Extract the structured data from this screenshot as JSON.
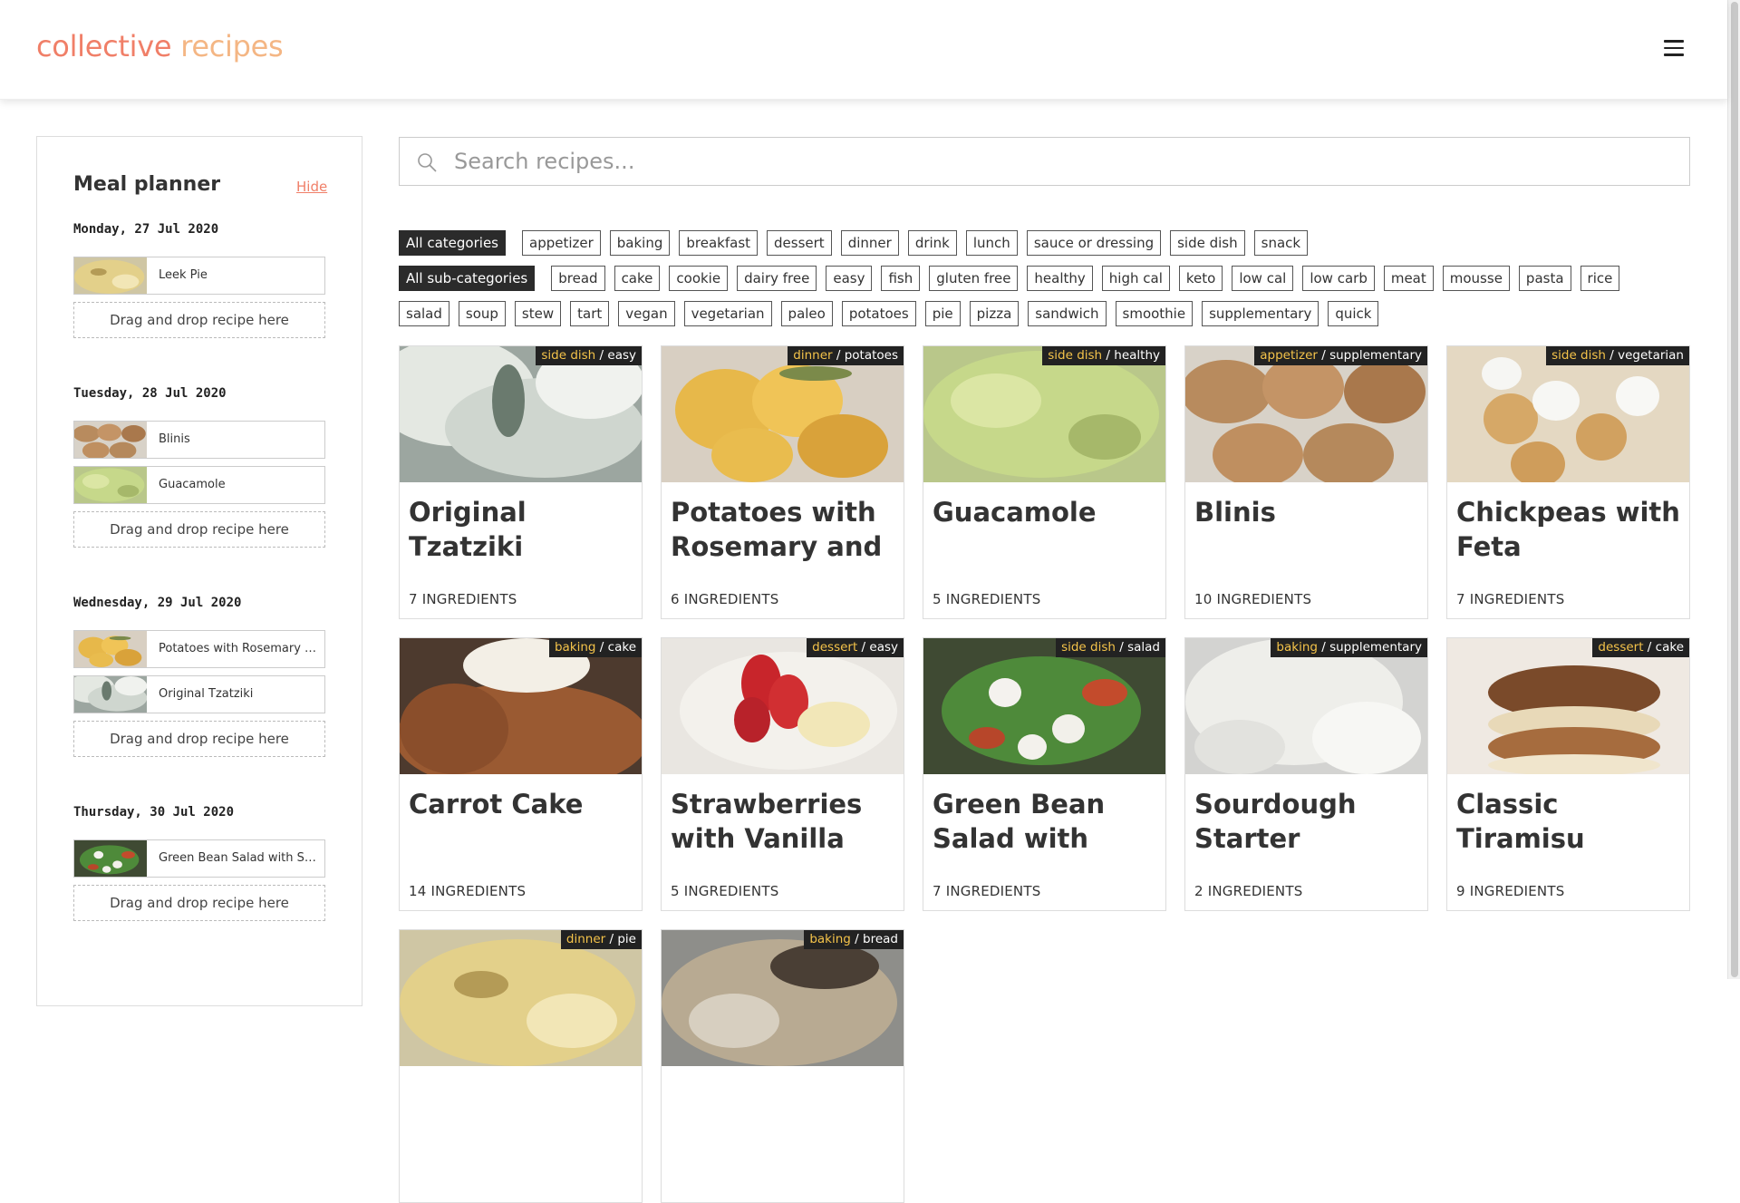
{
  "header": {
    "logo_word1": "collective",
    "logo_word2": "recipes",
    "menu_icon": "hamburger-menu-icon"
  },
  "colors": {
    "accent": "#f07f68",
    "accent_light": "#f4b684",
    "badge_category": "#f4c34a",
    "active_tag_bg": "#2b2b2b"
  },
  "planner": {
    "title": "Meal planner",
    "hide_label": "Hide",
    "drop_label": "Drag and drop recipe here",
    "days": [
      {
        "date": "Monday, 27 Jul 2020",
        "recipes": [
          {
            "name": "Leek Pie"
          }
        ]
      },
      {
        "date": "Tuesday, 28 Jul 2020",
        "recipes": [
          {
            "name": "Blinis"
          },
          {
            "name": "Guacamole"
          }
        ]
      },
      {
        "date": "Wednesday, 29 Jul 2020",
        "recipes": [
          {
            "name": "Potatoes with Rosemary a…"
          },
          {
            "name": "Original Tzatziki"
          }
        ]
      },
      {
        "date": "Thursday, 30 Jul 2020",
        "recipes": [
          {
            "name": "Green Bean Salad with Se…"
          }
        ]
      }
    ]
  },
  "search": {
    "placeholder": "Search recipes..."
  },
  "categories": {
    "all_label": "All categories",
    "items": [
      "appetizer",
      "baking",
      "breakfast",
      "dessert",
      "dinner",
      "drink",
      "lunch",
      "sauce or dressing",
      "side dish",
      "snack"
    ]
  },
  "subcategories": {
    "all_label": "All sub-categories",
    "row1": [
      "bread",
      "cake",
      "cookie",
      "dairy free",
      "easy",
      "fish",
      "gluten free",
      "healthy",
      "high cal",
      "keto",
      "low cal",
      "low carb",
      "meat",
      "mousse",
      "pasta",
      "rice"
    ],
    "row2": [
      "salad",
      "soup",
      "stew",
      "tart",
      "vegan",
      "vegetarian",
      "paleo",
      "potatoes",
      "pie",
      "pizza",
      "sandwich",
      "smoothie",
      "supplementary",
      "quick"
    ]
  },
  "recipes": [
    {
      "title": "Original Tzatziki",
      "category": "side dish",
      "sub": "easy",
      "ingredients": "7 INGREDIENTS"
    },
    {
      "title": "Potatoes with Rosemary and",
      "category": "dinner",
      "sub": "potatoes",
      "ingredients": "6 INGREDIENTS"
    },
    {
      "title": "Guacamole",
      "category": "side dish",
      "sub": "healthy",
      "ingredients": "5 INGREDIENTS"
    },
    {
      "title": "Blinis",
      "category": "appetizer",
      "sub": "supplementary",
      "ingredients": "10 INGREDIENTS"
    },
    {
      "title": "Chickpeas with Feta",
      "category": "side dish",
      "sub": "vegetarian",
      "ingredients": "7 INGREDIENTS"
    },
    {
      "title": "Carrot Cake",
      "category": "baking",
      "sub": "cake",
      "ingredients": "14 INGREDIENTS"
    },
    {
      "title": "Strawberries with Vanilla",
      "category": "dessert",
      "sub": "easy",
      "ingredients": "5 INGREDIENTS"
    },
    {
      "title": "Green Bean Salad with Semi-",
      "category": "side dish",
      "sub": "salad",
      "ingredients": "7 INGREDIENTS"
    },
    {
      "title": "Sourdough Starter",
      "category": "baking",
      "sub": "supplementary",
      "ingredients": "2 INGREDIENTS"
    },
    {
      "title": "Classic Tiramisu",
      "category": "dessert",
      "sub": "cake",
      "ingredients": "9 INGREDIENTS"
    },
    {
      "title": "",
      "category": "dinner",
      "sub": "pie",
      "ingredients": ""
    },
    {
      "title": "",
      "category": "baking",
      "sub": "bread",
      "ingredients": ""
    }
  ]
}
